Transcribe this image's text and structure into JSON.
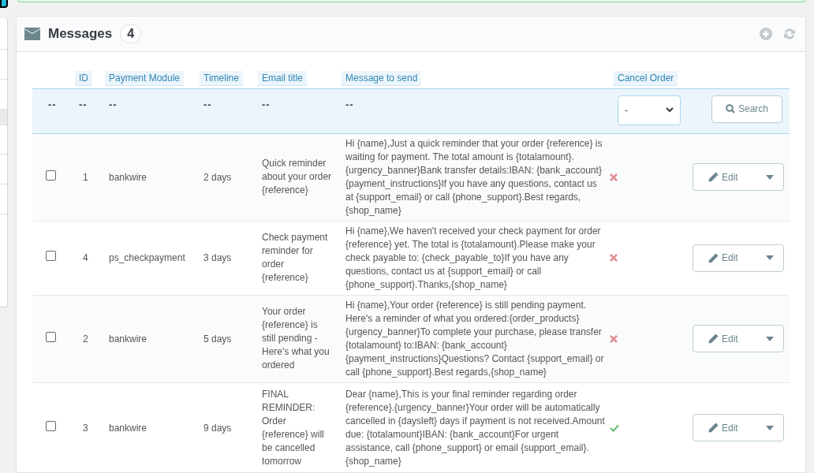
{
  "panel": {
    "title": "Messages",
    "count": "4"
  },
  "table": {
    "columns": [
      "ID",
      "Payment Module",
      "Timeline",
      "Email title",
      "Message to send",
      "Cancel Order"
    ],
    "filters": [
      "--",
      "--",
      "--",
      "--",
      "--",
      "--"
    ],
    "cancel_filter": {
      "value": "-"
    },
    "search_button": "Search",
    "rows": [
      {
        "checked": false,
        "id": "1",
        "module": "bankwire",
        "timeline": "2 days",
        "title": "Quick reminder about your order {reference}",
        "message": "Hi {name},Just a quick reminder that your order {reference} is waiting for payment. The total amount is {totalamount}.{urgency_banner}Bank transfer details:IBAN: {bank_account}{payment_instructions}If you have any questions, contact us at {support_email} or call {phone_support}.Best regards,{shop_name}",
        "cancel_order": false,
        "action": "Edit"
      },
      {
        "checked": false,
        "id": "4",
        "module": "ps_checkpayment",
        "timeline": "3 days",
        "title": "Check payment reminder for order {reference}",
        "message": "Hi {name},We haven't received your check payment for order {reference} yet. The total is {totalamount}.Please make your check payable to: {check_payable_to}If you have any questions, contact us at {support_email} or call {phone_support}.Thanks,{shop_name}",
        "cancel_order": false,
        "action": "Edit"
      },
      {
        "checked": false,
        "id": "2",
        "module": "bankwire",
        "timeline": "5 days",
        "title": "Your order {reference} is still pending - Here's what you ordered",
        "message": "Hi {name},Your order {reference} is still pending payment. Here's a reminder of what you ordered:{order_products}{urgency_banner}To complete your purchase, please transfer {totalamount} to:IBAN: {bank_account}{payment_instructions}Questions? Contact {support_email} or call {phone_support}.Best regards,{shop_name}",
        "cancel_order": false,
        "action": "Edit"
      },
      {
        "checked": false,
        "id": "3",
        "module": "bankwire",
        "timeline": "9 days",
        "title": "FINAL REMINDER: Order {reference} will be cancelled tomorrow",
        "message": "Dear {name},This is your final reminder regarding order {reference}.{urgency_banner}Your order will be automatically cancelled in {daysleft} days if payment is not received.Amount due: {totalamount}IBAN: {bank_account}For urgent assistance, call {phone_support} or email {support_email}.{shop_name}",
        "cancel_order": true,
        "action": "Edit"
      }
    ]
  }
}
